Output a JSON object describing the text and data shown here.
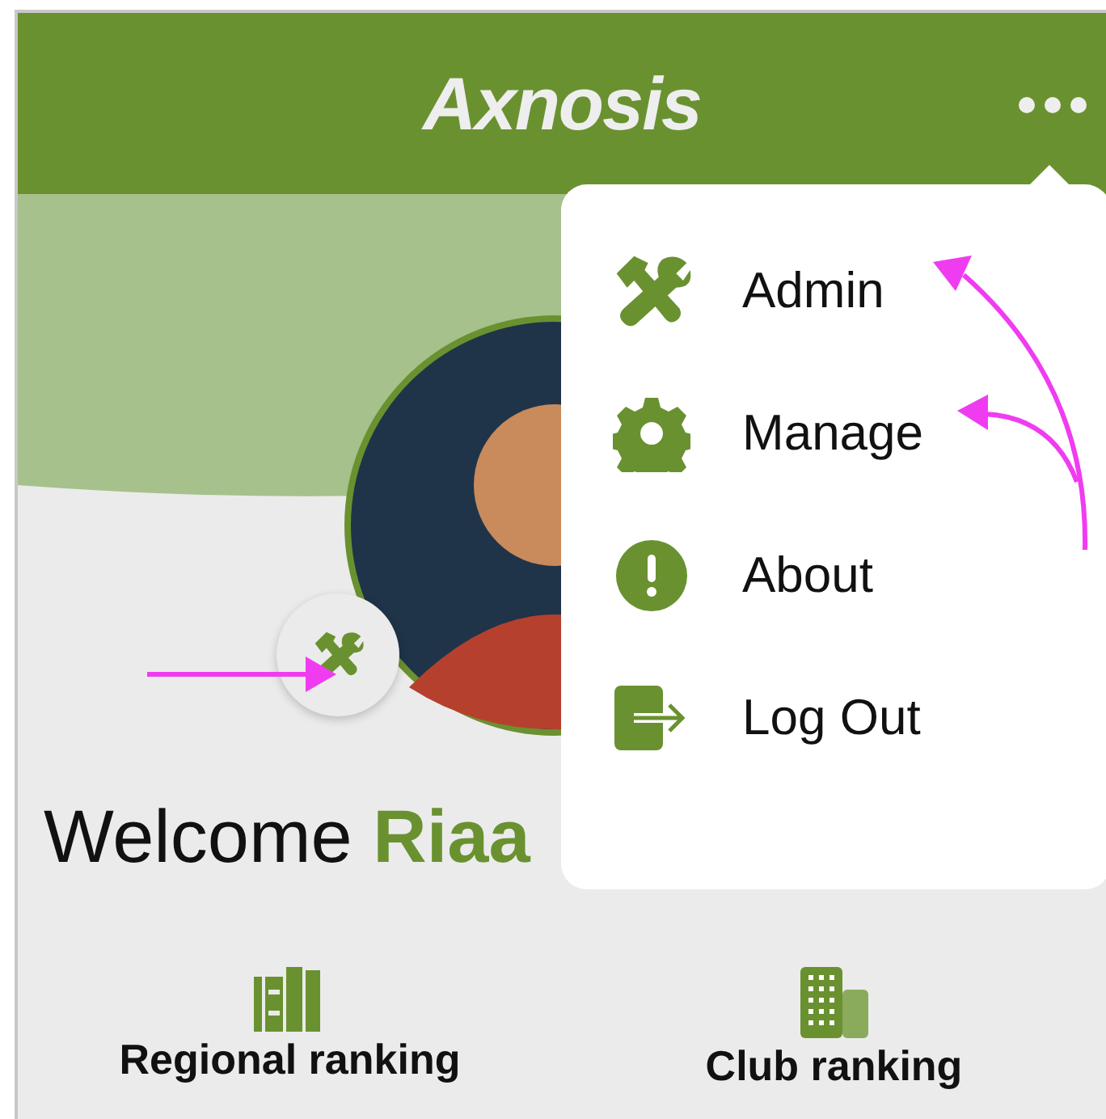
{
  "header": {
    "logo": "Axnosis"
  },
  "welcome": "Welcome **Riaa**",
  "rankings": [
    {
      "label": "Regional ranking",
      "kind": "books"
    },
    {
      "label": "Club ranking",
      "kind": "building"
    }
  ],
  "menu": {
    "open": true,
    "items": [
      {
        "label": "Admin",
        "kind": "tools"
      },
      {
        "label": "Manage",
        "kind": "settings"
      },
      {
        "label": "About",
        "kind": "info"
      },
      {
        "label": "Log Out",
        "kind": "logout"
      }
    ]
  }
}
